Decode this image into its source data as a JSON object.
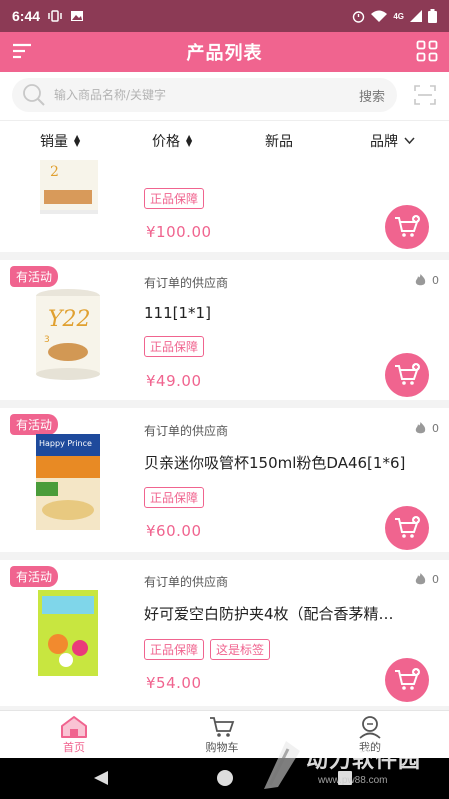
{
  "status_bar": {
    "time": "6:44",
    "network": "4G"
  },
  "header": {
    "title": "产品列表"
  },
  "search": {
    "placeholder": "输入商品名称/关键字",
    "button_label": "搜索"
  },
  "sort_bar": {
    "items": [
      {
        "label": "销量",
        "indicator": "sort-arrows"
      },
      {
        "label": "价格",
        "indicator": "sort-arrows"
      },
      {
        "label": "新品",
        "indicator": ""
      },
      {
        "label": "品牌",
        "indicator": "chevron-down"
      }
    ]
  },
  "products": [
    {
      "badge": "",
      "supplier": "",
      "hot_count": "",
      "name": "",
      "tags": [
        "正品保障"
      ],
      "price": "¥100.00",
      "image": "formula-can-gold"
    },
    {
      "badge": "有活动",
      "supplier": "有订单的供应商",
      "hot_count": "0",
      "name": "111[1*1]",
      "tags": [
        "正品保障"
      ],
      "price": "¥49.00",
      "image": "formula-can-gold"
    },
    {
      "badge": "有活动",
      "supplier": "有订单的供应商",
      "hot_count": "0",
      "name": "贝亲迷你吸管杯150ml粉色DA46[1*6]",
      "tags": [
        "正品保障"
      ],
      "price": "¥60.00",
      "image": "formula-can-happy-prince"
    },
    {
      "badge": "有活动",
      "supplier": "有订单的供应商",
      "hot_count": "0",
      "name": "好可爱空白防护夹4枚（配合香茅精…",
      "tags": [
        "正品保障",
        "这是标签"
      ],
      "price": "¥54.00",
      "image": "clip-package"
    }
  ],
  "tab_bar": {
    "tabs": [
      {
        "label": "首页",
        "icon": "home-icon",
        "active": true
      },
      {
        "label": "购物车",
        "icon": "cart-icon",
        "active": false
      },
      {
        "label": "我的",
        "icon": "user-icon",
        "active": false
      }
    ]
  },
  "watermark": {
    "text": "动力软件园",
    "url": "www.pw88.com"
  },
  "colors": {
    "accent": "#f0648f",
    "status_bar": "#8c3a55"
  }
}
